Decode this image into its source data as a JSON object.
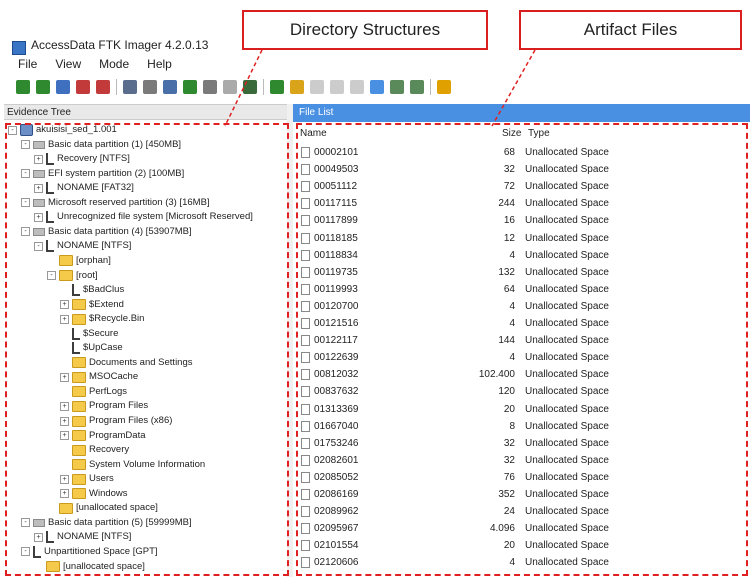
{
  "window": {
    "title": "AccessData FTK Imager 4.2.0.13"
  },
  "menu": [
    "File",
    "View",
    "Mode",
    "Help"
  ],
  "toolbar": {
    "icons": [
      "add-evidence-icon",
      "add-all-icon",
      "image-icon",
      "remove-icon",
      "remove-all-icon",
      "create-image-icon",
      "export-icon",
      "capture-memory-icon",
      "obtain-files-icon",
      "mount-icon",
      "unmount-icon",
      "minus-icon",
      "detect-encryption-icon",
      "decrypt-icon",
      "export-files-icon",
      "hash-icon",
      "list-icon",
      "auto-view-icon",
      "text-view-icon",
      "hex-view-icon",
      "help-icon"
    ]
  },
  "panels": {
    "evidence_tree": "Evidence Tree",
    "file_list": "File List"
  },
  "tree": [
    {
      "label": "akuisisi_sed_1.001",
      "depth": 0,
      "icon": "disk",
      "exp": "-"
    },
    {
      "label": "Basic data partition (1) [450MB]",
      "depth": 1,
      "icon": "drive",
      "exp": "-"
    },
    {
      "label": "Recovery [NTFS]",
      "depth": 2,
      "icon": "fs",
      "exp": "+"
    },
    {
      "label": "EFI system partition (2) [100MB]",
      "depth": 1,
      "icon": "drive",
      "exp": "-"
    },
    {
      "label": "NONAME [FAT32]",
      "depth": 2,
      "icon": "fs",
      "exp": "+"
    },
    {
      "label": "Microsoft reserved partition (3) [16MB]",
      "depth": 1,
      "icon": "drive",
      "exp": "-"
    },
    {
      "label": "Unrecognized file system [Microsoft Reserved]",
      "depth": 2,
      "icon": "fs",
      "exp": "+"
    },
    {
      "label": "Basic data partition (4) [53907MB]",
      "depth": 1,
      "icon": "drive",
      "exp": "-"
    },
    {
      "label": "NONAME [NTFS]",
      "depth": 2,
      "icon": "fs",
      "exp": "-"
    },
    {
      "label": "[orphan]",
      "depth": 3,
      "icon": "folder",
      "exp": ""
    },
    {
      "label": "[root]",
      "depth": 3,
      "icon": "folder",
      "exp": "-"
    },
    {
      "label": "$BadClus",
      "depth": 4,
      "icon": "fs",
      "exp": ""
    },
    {
      "label": "$Extend",
      "depth": 4,
      "icon": "folder",
      "exp": "+"
    },
    {
      "label": "$Recycle.Bin",
      "depth": 4,
      "icon": "folder",
      "exp": "+"
    },
    {
      "label": "$Secure",
      "depth": 4,
      "icon": "fs",
      "exp": ""
    },
    {
      "label": "$UpCase",
      "depth": 4,
      "icon": "fs",
      "exp": ""
    },
    {
      "label": "Documents and Settings",
      "depth": 4,
      "icon": "folder",
      "exp": ""
    },
    {
      "label": "MSOCache",
      "depth": 4,
      "icon": "folder",
      "exp": "+"
    },
    {
      "label": "PerfLogs",
      "depth": 4,
      "icon": "folder",
      "exp": ""
    },
    {
      "label": "Program Files",
      "depth": 4,
      "icon": "folder",
      "exp": "+"
    },
    {
      "label": "Program Files (x86)",
      "depth": 4,
      "icon": "folder",
      "exp": "+"
    },
    {
      "label": "ProgramData",
      "depth": 4,
      "icon": "folder",
      "exp": "+"
    },
    {
      "label": "Recovery",
      "depth": 4,
      "icon": "folder",
      "exp": ""
    },
    {
      "label": "System Volume Information",
      "depth": 4,
      "icon": "folder",
      "exp": ""
    },
    {
      "label": "Users",
      "depth": 4,
      "icon": "folder",
      "exp": "+"
    },
    {
      "label": "Windows",
      "depth": 4,
      "icon": "folder",
      "exp": "+"
    },
    {
      "label": "[unallocated space]",
      "depth": 3,
      "icon": "folder",
      "exp": ""
    },
    {
      "label": "Basic data partition (5) [59999MB]",
      "depth": 1,
      "icon": "drive",
      "exp": "-"
    },
    {
      "label": "NONAME [NTFS]",
      "depth": 2,
      "icon": "fs",
      "exp": "+"
    },
    {
      "label": "Unpartitioned Space [GPT]",
      "depth": 1,
      "icon": "fs",
      "exp": "-"
    },
    {
      "label": "[unallocated space]",
      "depth": 2,
      "icon": "folder",
      "exp": ""
    }
  ],
  "file_list": {
    "columns": {
      "name": "Name",
      "size": "Size",
      "type": "Type"
    },
    "rows": [
      {
        "name": "00002101",
        "size": "68",
        "type": "Unallocated Space"
      },
      {
        "name": "00049503",
        "size": "32",
        "type": "Unallocated Space"
      },
      {
        "name": "00051112",
        "size": "72",
        "type": "Unallocated Space"
      },
      {
        "name": "00117115",
        "size": "244",
        "type": "Unallocated Space"
      },
      {
        "name": "00117899",
        "size": "16",
        "type": "Unallocated Space"
      },
      {
        "name": "00118185",
        "size": "12",
        "type": "Unallocated Space"
      },
      {
        "name": "00118834",
        "size": "4",
        "type": "Unallocated Space"
      },
      {
        "name": "00119735",
        "size": "132",
        "type": "Unallocated Space"
      },
      {
        "name": "00119993",
        "size": "64",
        "type": "Unallocated Space"
      },
      {
        "name": "00120700",
        "size": "4",
        "type": "Unallocated Space"
      },
      {
        "name": "00121516",
        "size": "4",
        "type": "Unallocated Space"
      },
      {
        "name": "00122117",
        "size": "144",
        "type": "Unallocated Space"
      },
      {
        "name": "00122639",
        "size": "4",
        "type": "Unallocated Space"
      },
      {
        "name": "00812032",
        "size": "102.400",
        "type": "Unallocated Space"
      },
      {
        "name": "00837632",
        "size": "120",
        "type": "Unallocated Space"
      },
      {
        "name": "01313369",
        "size": "20",
        "type": "Unallocated Space"
      },
      {
        "name": "01667040",
        "size": "8",
        "type": "Unallocated Space"
      },
      {
        "name": "01753246",
        "size": "32",
        "type": "Unallocated Space"
      },
      {
        "name": "02082601",
        "size": "32",
        "type": "Unallocated Space"
      },
      {
        "name": "02085052",
        "size": "76",
        "type": "Unallocated Space"
      },
      {
        "name": "02086169",
        "size": "352",
        "type": "Unallocated Space"
      },
      {
        "name": "02089962",
        "size": "24",
        "type": "Unallocated Space"
      },
      {
        "name": "02095967",
        "size": "4.096",
        "type": "Unallocated Space"
      },
      {
        "name": "02101554",
        "size": "20",
        "type": "Unallocated Space"
      },
      {
        "name": "02120606",
        "size": "4",
        "type": "Unallocated Space"
      }
    ]
  },
  "annotations": {
    "directory": "Directory Structures",
    "artifact": "Artifact Files",
    "color": "#e02020"
  }
}
